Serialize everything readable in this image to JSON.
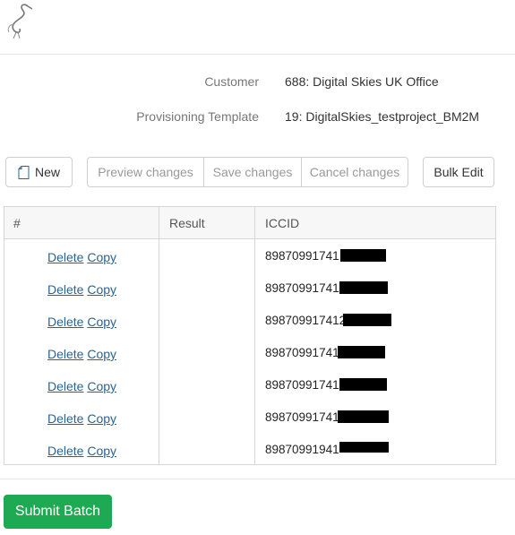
{
  "header": {
    "logo_icon": "heron-logo-icon"
  },
  "info": {
    "customer_label": "Customer",
    "customer_value": "688: Digital Skies UK Office",
    "template_label": "Provisioning Template",
    "template_value": "19: DigitalSkies_testproject_BM2M"
  },
  "toolbar": {
    "new_label": "New",
    "new_icon": "file-icon",
    "preview_label": "Preview changes",
    "save_label": "Save changes",
    "cancel_label": "Cancel changes",
    "bulk_label": "Bulk Edit"
  },
  "table": {
    "headers": [
      "#",
      "Result",
      "ICCID"
    ],
    "rows": [
      {
        "delete": "Delete",
        "copy": "Copy",
        "result": "",
        "iccid": "89870991741"
      },
      {
        "delete": "Delete",
        "copy": "Copy",
        "result": "",
        "iccid": "89870991741"
      },
      {
        "delete": "Delete",
        "copy": "Copy",
        "result": "",
        "iccid": "898709917412"
      },
      {
        "delete": "Delete",
        "copy": "Copy",
        "result": "",
        "iccid": "89870991741"
      },
      {
        "delete": "Delete",
        "copy": "Copy",
        "result": "",
        "iccid": "89870991741"
      },
      {
        "delete": "Delete",
        "copy": "Copy",
        "result": "",
        "iccid": "89870991741"
      },
      {
        "delete": "Delete",
        "copy": "Copy",
        "result": "",
        "iccid": "89870991941"
      }
    ]
  },
  "footer": {
    "submit_label": "Submit Batch"
  },
  "colors": {
    "submit_bg": "#1eaa53",
    "link": "#2a6496"
  }
}
